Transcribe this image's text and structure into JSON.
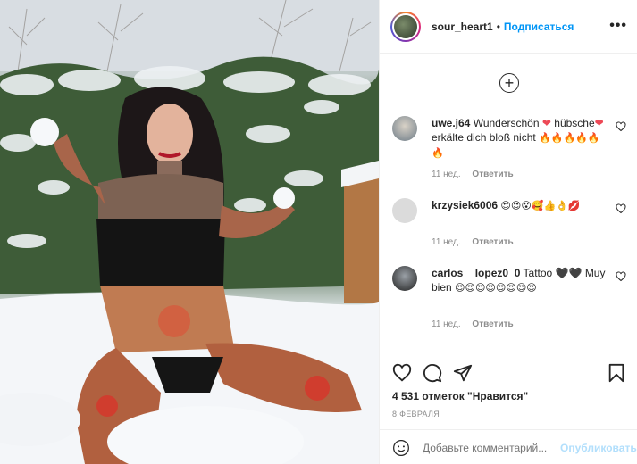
{
  "post": {
    "author": "sour_heart1",
    "separator": "•",
    "follow_label": "Подписаться",
    "more_label": "•••",
    "load_more_symbol": "+",
    "comments": [
      {
        "user": "uwe.j64",
        "text_1": "Wunderschön",
        "heart_1": "❤",
        "text_2": "hübsche",
        "heart_2": "❤",
        "text_3": "erkälte dich bloß nicht",
        "emojis": "🔥🔥🔥🔥🔥🔥",
        "time": "11 нед.",
        "reply_label": "Ответить"
      },
      {
        "user": "krzysiek6006",
        "emojis": "😍😍😮🥰👍👌💋",
        "time": "11 нед.",
        "reply_label": "Ответить"
      },
      {
        "user": "carlos__lopez0_0",
        "text_1": "Tattoo",
        "hearts": "🖤🖤",
        "text_2": "Muy bien",
        "emojis": "😍😍😍😍😍😍😍😍",
        "time": "11 нед.",
        "reply_label": "Ответить"
      }
    ],
    "likes_text": "4 531 отметок \"Нравится\"",
    "date_text": "8 ФЕВРАЛЯ",
    "comment_placeholder": "Добавьте комментарий...",
    "publish_label": "Опубликовать"
  },
  "colors": {
    "link_blue": "#0095f6",
    "publish_disabled": "#b2dffc",
    "muted_text": "#8e8e8e",
    "border": "#efefef"
  },
  "icons": [
    "more-options-icon",
    "load-more-icon",
    "heart-icon",
    "comment-icon",
    "share-icon",
    "bookmark-icon",
    "emoji-icon"
  ]
}
